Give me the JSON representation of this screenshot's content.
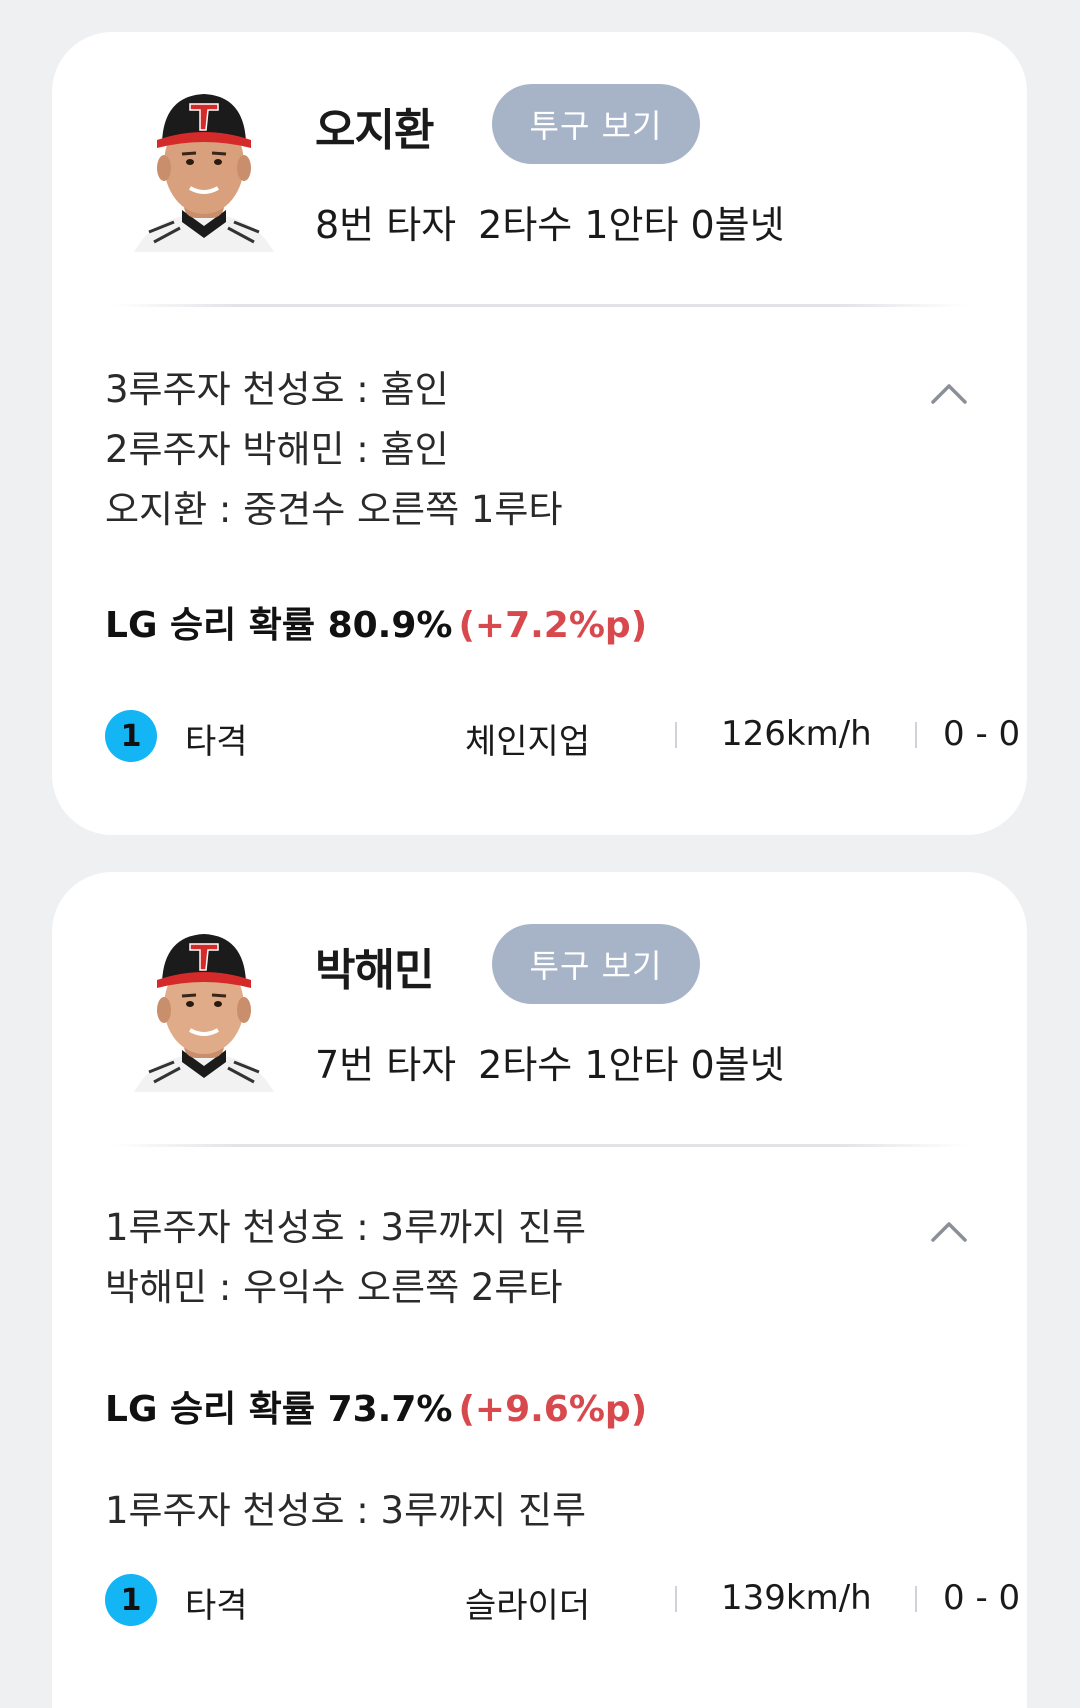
{
  "cards": [
    {
      "player_name": "오지환",
      "pitch_button_label": "투구 보기",
      "batting_order": "8번 타자",
      "stat_line": "2타수 1안타 0볼넷",
      "plays": [
        "3루주자 천성호 : 홈인",
        "2루주자 박해민 : 홈인",
        "오지환 : 중견수 오른쪽 1루타"
      ],
      "win_prob": "LG 승리 확률 80.9%",
      "win_prob_delta": "(+7.2%p)",
      "pitch": {
        "number": "1",
        "result": "타격",
        "type": "체인지업",
        "speed": "126km/h",
        "count": "0 - 0"
      }
    },
    {
      "player_name": "박해민",
      "pitch_button_label": "투구 보기",
      "batting_order": "7번 타자",
      "stat_line": "2타수 1안타 0볼넷",
      "plays": [
        "1루주자 천성호 : 3루까지 진루",
        "박해민 : 우익수 오른쪽 2루타"
      ],
      "win_prob": "LG 승리 확률 73.7%",
      "win_prob_delta": "(+9.6%p)",
      "extra_line": "1루주자 천성호 : 3루까지 진루",
      "pitch": {
        "number": "1",
        "result": "타격",
        "type": "슬라이더",
        "speed": "139km/h",
        "count": "0 - 0"
      }
    }
  ],
  "colors": {
    "accent_blue": "#14b5f5",
    "delta_red": "#d8494e",
    "button_gray": "#a7b4c7",
    "cap_black": "#1b1b1b",
    "cap_red": "#d42a2a"
  },
  "icons": {
    "collapse": "chevron-up-icon",
    "avatar": "player-avatar"
  }
}
